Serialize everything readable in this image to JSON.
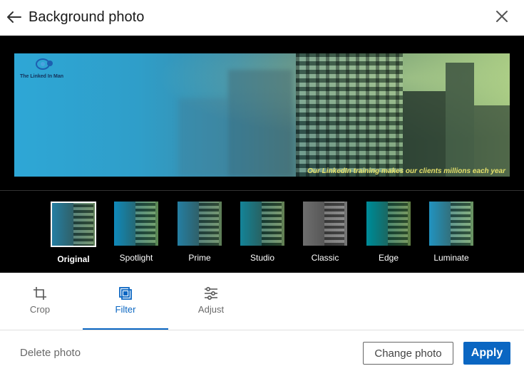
{
  "header": {
    "title": "Background photo",
    "back_icon": "arrow-left-icon",
    "close_icon": "close-icon"
  },
  "preview": {
    "logo_text": "The Linked In Man",
    "tagline": "Our LinkedIn training makes our clients millions each year"
  },
  "filters": {
    "selected": "Original",
    "items": [
      {
        "label": "Original"
      },
      {
        "label": "Spotlight"
      },
      {
        "label": "Prime"
      },
      {
        "label": "Studio"
      },
      {
        "label": "Classic"
      },
      {
        "label": "Edge"
      },
      {
        "label": "Luminate"
      }
    ]
  },
  "tools": {
    "active": "Filter",
    "items": [
      {
        "label": "Crop",
        "icon": "crop-icon"
      },
      {
        "label": "Filter",
        "icon": "filter-icon"
      },
      {
        "label": "Adjust",
        "icon": "sliders-icon"
      }
    ]
  },
  "footer": {
    "delete_label": "Delete photo",
    "change_label": "Change photo",
    "apply_label": "Apply"
  },
  "colors": {
    "accent": "#0a66c2",
    "stage_bg": "#000000",
    "tagline": "#e4e06a"
  }
}
